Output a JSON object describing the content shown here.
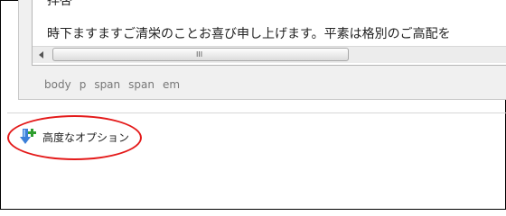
{
  "editor": {
    "line_top": "拝啓",
    "line_body": "時下ますますご清栄のことお喜び申し上げます。平素は格別のご高配を",
    "scroll_grip": "III",
    "path": [
      "body",
      "p",
      "span",
      "span",
      "em"
    ]
  },
  "advanced": {
    "label": "高度なオプション",
    "icon": "blue-down-arrow-with-green-plus"
  },
  "colors": {
    "highlight": "#e41a1a",
    "arrow": "#3b7fd8",
    "plus": "#2e9e2e"
  }
}
